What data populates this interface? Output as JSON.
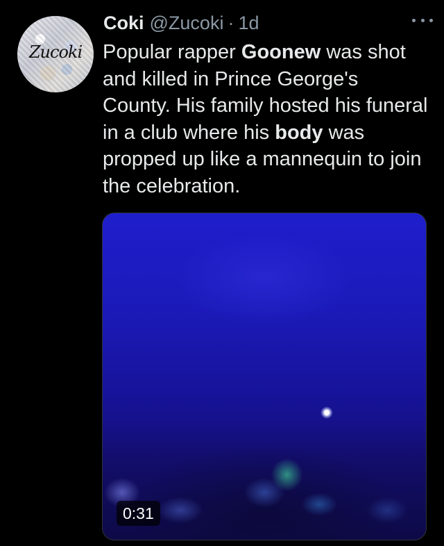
{
  "tweet": {
    "avatar_text": "Zucoki",
    "display_name": "Coki",
    "handle": "@Zucoki",
    "separator": "·",
    "time": "1d",
    "more_icon": "more-horizontal-icon",
    "text_segments": [
      "Popular rapper ",
      "Goonew",
      " was shot and killed in Prince George's County. His family hosted his funeral in a club where his ",
      "body",
      " was propped up like a mannequin to join the celebration."
    ],
    "media": {
      "type": "video",
      "duration": "0:31"
    }
  },
  "colors": {
    "background": "#000000",
    "text_primary": "#e7e9ea",
    "text_secondary": "#8b98a5"
  }
}
